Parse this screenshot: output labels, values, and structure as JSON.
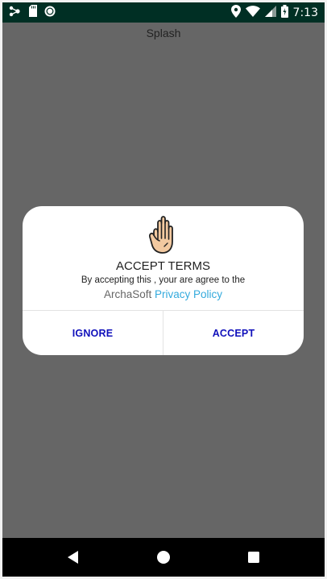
{
  "status_bar": {
    "time": "7:13",
    "left_icons": [
      "network-icon",
      "sd-card-icon",
      "record-icon"
    ],
    "right_icons": [
      "location-icon",
      "wifi-icon",
      "cell-signal-icon",
      "battery-icon"
    ]
  },
  "app": {
    "title": "Splash"
  },
  "dialog": {
    "icon": "raised-hand-icon",
    "title": "ACCEPT TERMS",
    "message": "By accepting this , your are agree to the",
    "policy_prefix": "ArchaSoft ",
    "policy_link": "Privacy Policy",
    "ignore_label": "IGNORE",
    "accept_label": "ACCEPT"
  },
  "nav_bar": {
    "buttons": [
      "back-icon",
      "home-icon",
      "recents-icon"
    ]
  },
  "colors": {
    "status_bar": "#002f24",
    "overlay": "#666666",
    "dialog_bg": "#ffffff",
    "button_text": "#1010bb",
    "link": "#33aadd",
    "nav_bar": "#000000"
  }
}
